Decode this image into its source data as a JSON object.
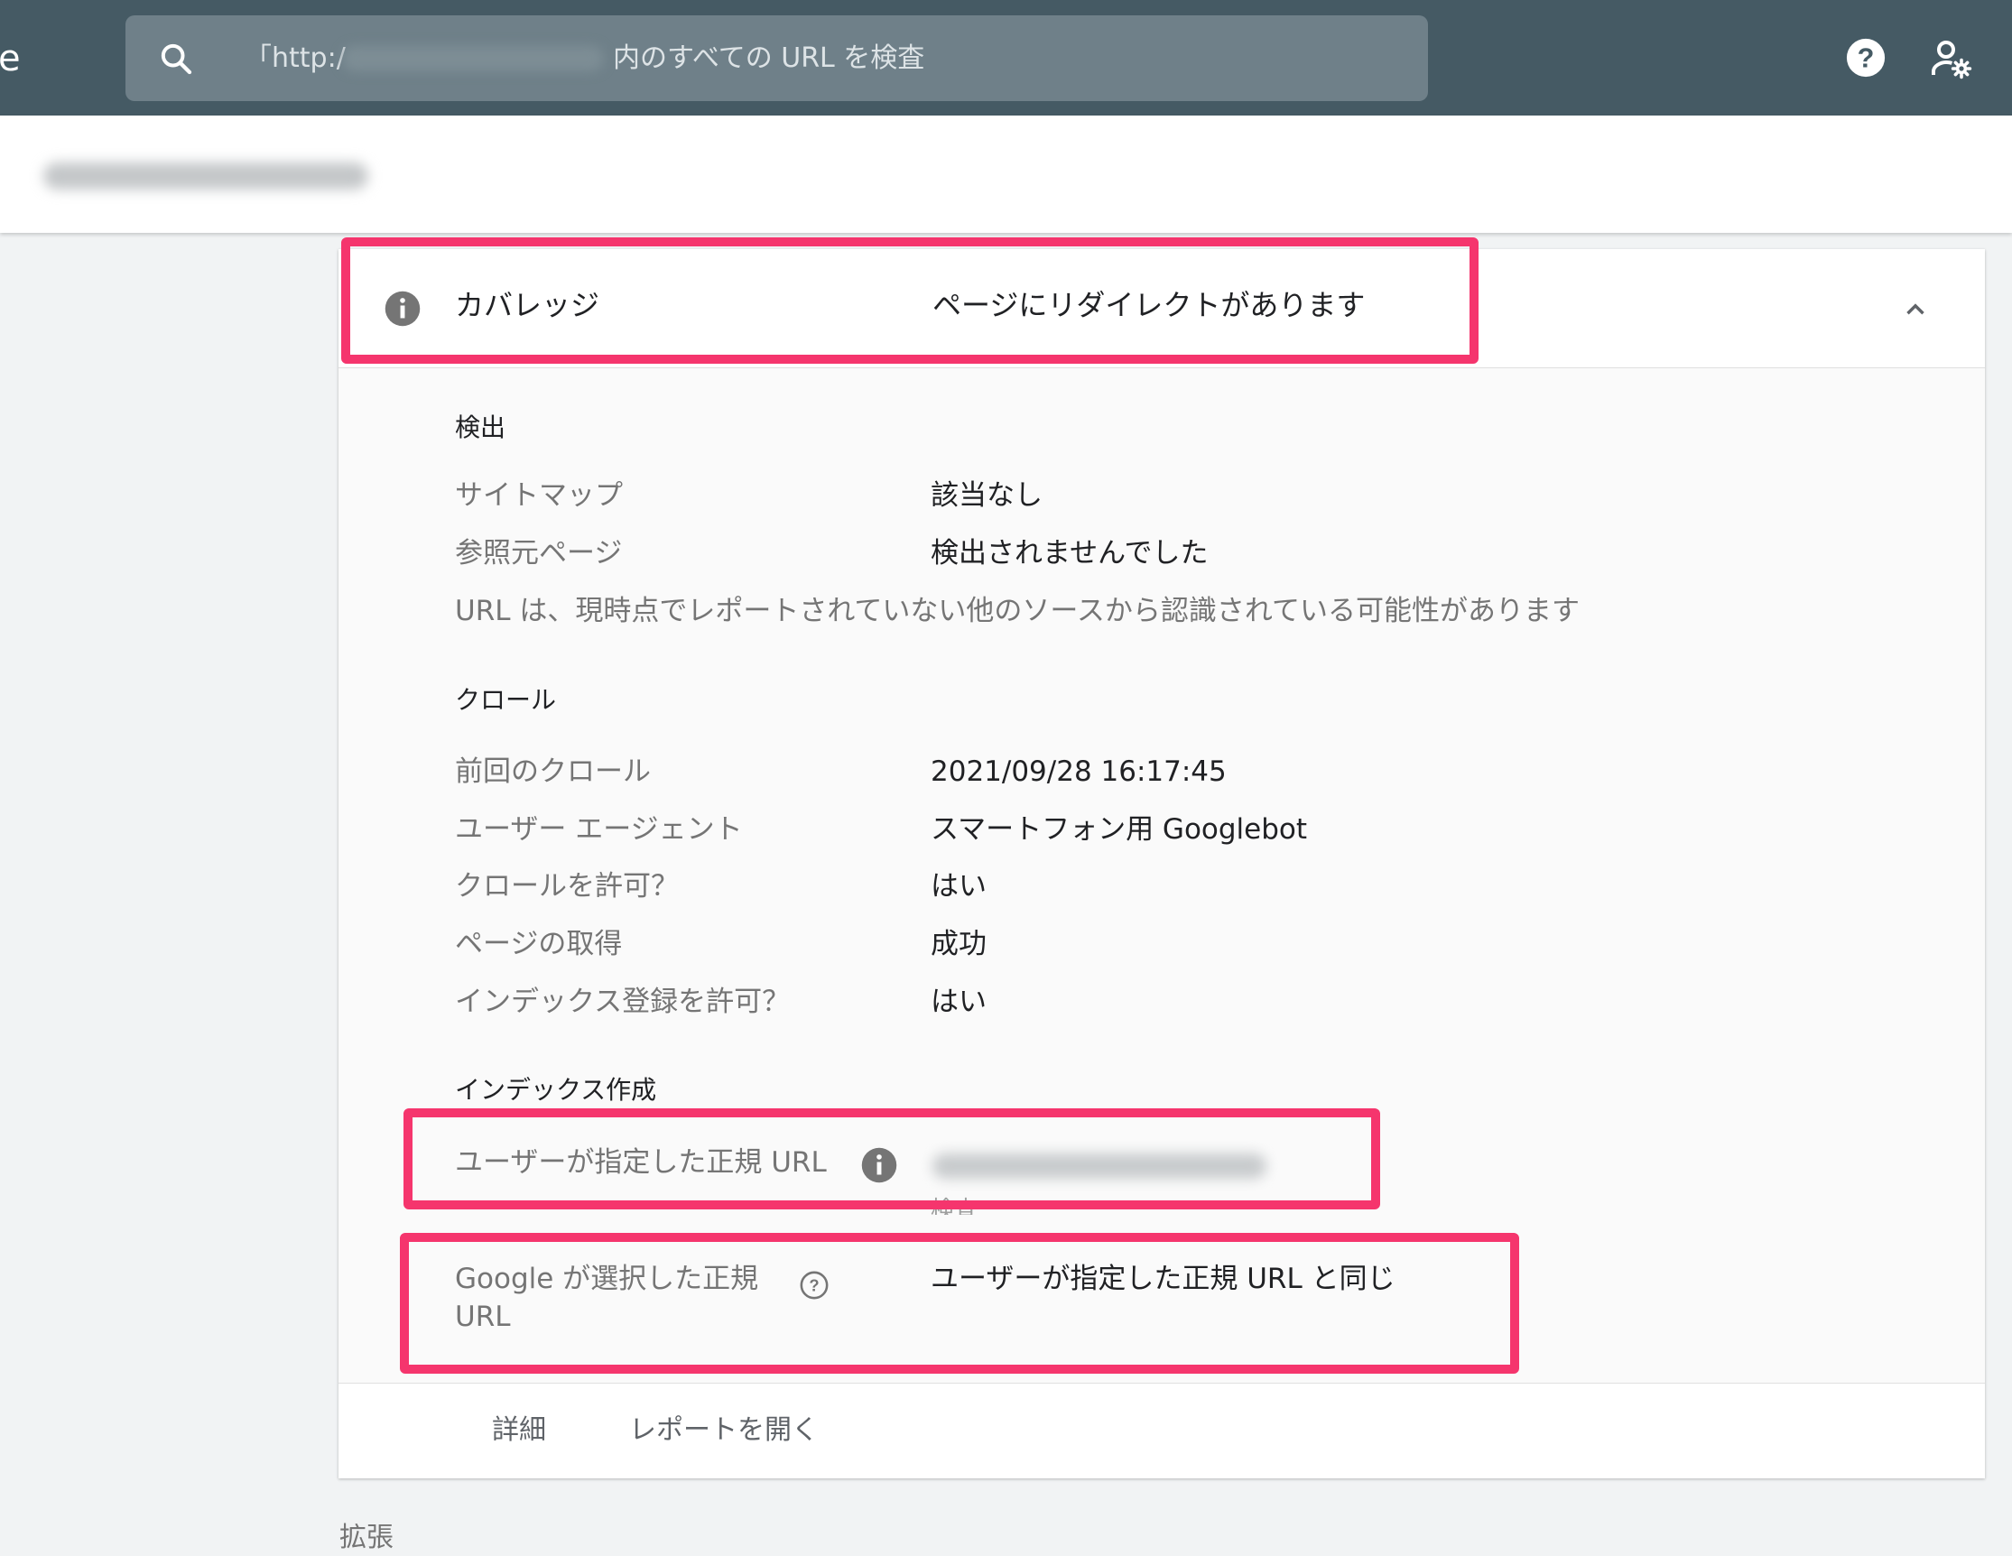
{
  "topbar": {
    "brand_fragment": "e",
    "search": {
      "prefix": "「http:/",
      "suffix": "内のすべての URL を検査"
    },
    "icons": [
      "search-icon",
      "help-icon",
      "admin-settings-icon"
    ]
  },
  "coverage": {
    "label": "カバレッジ",
    "value": "ページにリダイレクトがあります",
    "icons": [
      "info-icon",
      "chevron-up-icon"
    ]
  },
  "discovery": {
    "title": "検出",
    "rows": [
      {
        "label": "サイトマップ",
        "value": "該当なし"
      },
      {
        "label": "参照元ページ",
        "value": "検出されませんでした"
      }
    ],
    "note": "URL は、現時点でレポートされていない他のソースから認識されている可能性があります"
  },
  "crawl": {
    "title": "クロール",
    "rows": [
      {
        "label": "前回のクロール",
        "value": "2021/09/28 16:17:45"
      },
      {
        "label": "ユーザー エージェント",
        "value": "スマートフォン用 Googlebot"
      },
      {
        "label": "クロールを許可？",
        "value": "はい"
      },
      {
        "label": "ページの取得",
        "value": "成功"
      },
      {
        "label": "インデックス登録を許可？",
        "value": "はい"
      }
    ]
  },
  "indexing": {
    "title": "インデックス作成",
    "user_canonical": {
      "label": "ユーザーが指定した正規 URL",
      "link": "検査"
    },
    "google_canonical": {
      "label": "Google が選択した正規 URL",
      "value": "ユーザーが指定した正規 URL と同じ"
    }
  },
  "footer": {
    "details": "詳細",
    "open_report": "レポートを開く"
  },
  "next_section": "拡張",
  "colors": {
    "topbar": "#455a64",
    "highlight": "#f5356d"
  }
}
